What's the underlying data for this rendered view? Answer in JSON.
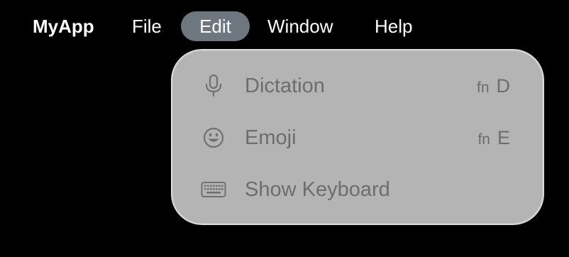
{
  "menubar": {
    "app_name": "MyApp",
    "items": [
      {
        "label": "File"
      },
      {
        "label": "Edit",
        "active": true
      },
      {
        "label": "Window"
      },
      {
        "label": "Help"
      }
    ]
  },
  "edit_menu": {
    "items": [
      {
        "icon": "microphone-icon",
        "label": "Dictation",
        "shortcut_modifier": "fn",
        "shortcut_key": "D"
      },
      {
        "icon": "emoji-smiley-icon",
        "label": "Emoji",
        "shortcut_modifier": "fn",
        "shortcut_key": "E"
      },
      {
        "icon": "keyboard-icon",
        "label": "Show Keyboard"
      }
    ]
  },
  "colors": {
    "background": "#000000",
    "menubar_text": "#ffffff",
    "active_menu_pill": "#6e7680",
    "dropdown_background": "#b3b4b3",
    "dropdown_border": "#d9dad9",
    "dropdown_item_text": "#6c6d6c",
    "dropdown_icon": "#707170"
  }
}
